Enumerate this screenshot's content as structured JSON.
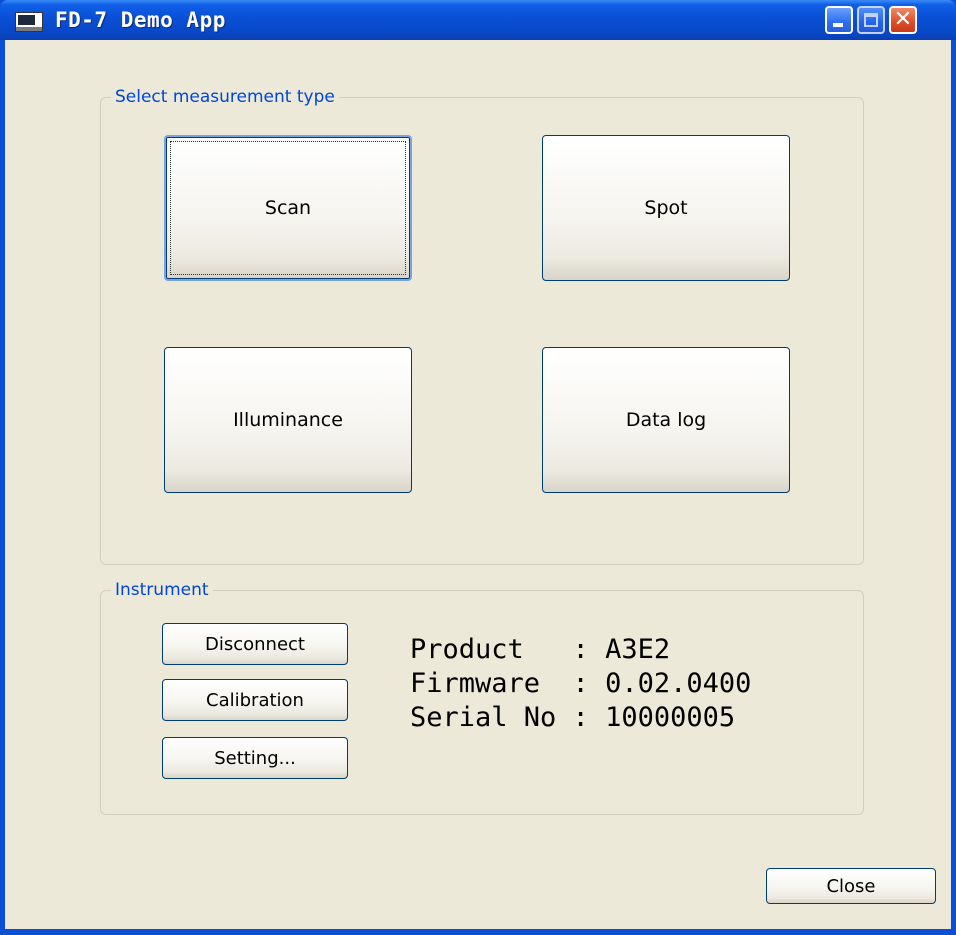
{
  "window": {
    "title": "FD-7 Demo App"
  },
  "measurement_group": {
    "label": "Select measurement type",
    "buttons": {
      "scan": "Scan",
      "spot": "Spot",
      "illuminance": "Illuminance",
      "data_log": "Data log"
    }
  },
  "instrument_group": {
    "label": "Instrument",
    "buttons": {
      "disconnect": "Disconnect",
      "calibration": "Calibration",
      "setting": "Setting..."
    },
    "info": {
      "product_label": "Product   : ",
      "product_value": "A3E2",
      "firmware_label": "Firmware  : ",
      "firmware_value": "0.02.0400",
      "serial_label": "Serial No : ",
      "serial_value": "10000005"
    }
  },
  "footer": {
    "close_label": "Close"
  },
  "icons": {
    "app": "app-monitor-icon",
    "minimize": "minimize-icon",
    "maximize": "maximize-icon",
    "close": "close-icon"
  },
  "colors": {
    "titlebar": "#0a4fd6",
    "client_bg": "#ece9d8",
    "group_label": "#0046d5",
    "button_border": "#003c74"
  }
}
